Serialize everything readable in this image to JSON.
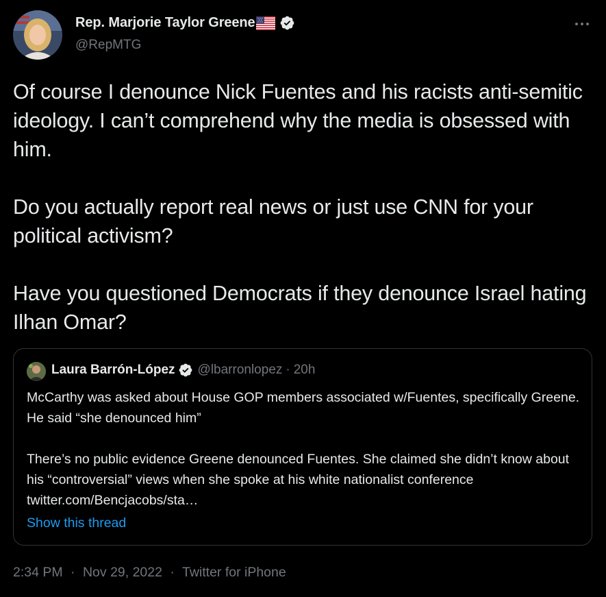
{
  "author": {
    "display_name": "Rep. Marjorie Taylor Greene",
    "flag_icon": "us-flag-emoji",
    "verified_icon": "verified-badge-icon",
    "handle": "@RepMTG"
  },
  "more_icon": "more-options-icon",
  "tweet": {
    "paragraphs": [
      "Of course I denounce Nick Fuentes and his racists anti-semitic ideology. I can’t comprehend why the media is obsessed with him.",
      "Do you actually report real news or just use CNN for your political activism?",
      "Have you questioned Democrats if they denounce Israel hating Ilhan Omar?"
    ]
  },
  "quote": {
    "display_name": "Laura Barrón-López",
    "handle": "@lbarronlopez",
    "separator": "·",
    "time": "20h",
    "paragraphs": [
      "McCarthy was asked about House GOP members associated w/Fuentes, specifically Greene. He said “she denounced him”",
      "There’s no public evidence Greene denounced Fuentes. She claimed she didn’t know about his “controversial” views when she spoke at his white nationalist conference twitter.com/Bencjacobs/sta…"
    ],
    "show_thread": "Show this thread"
  },
  "meta": {
    "time": "2:34 PM",
    "date": "Nov 29, 2022",
    "source": "Twitter for iPhone",
    "separator": "·"
  },
  "colors": {
    "background": "#000000",
    "text": "#e7e9ea",
    "muted": "#71767b",
    "link": "#1d9bf0",
    "border": "#2f3336"
  }
}
